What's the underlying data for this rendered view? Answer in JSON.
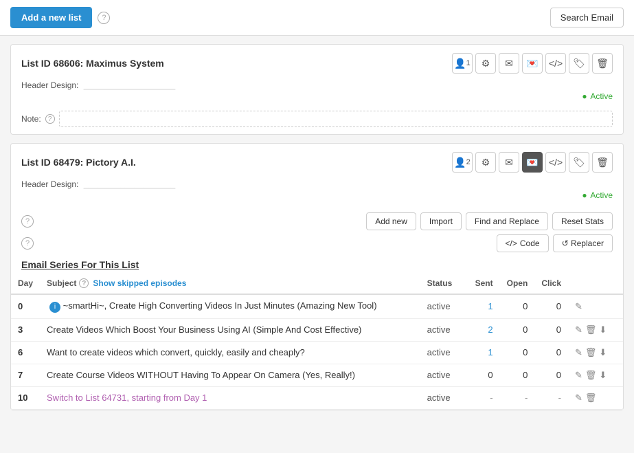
{
  "topBar": {
    "addNewListLabel": "Add a new list",
    "searchEmailLabel": "Search Email"
  },
  "lists": [
    {
      "id": "list-68606",
      "title": "List ID 68606: Maximus System",
      "headerDesignLabel": "Header Design:",
      "headerDesignValue": "____________________",
      "noteLabel": "Note:",
      "notePlaceholder": "",
      "status": "Active",
      "subscriberCount": "1",
      "actions": [
        "person-icon",
        "gear-icon",
        "email-icon",
        "envelope-icon",
        "code-icon",
        "tag-icon",
        "trash-icon"
      ]
    },
    {
      "id": "list-68479",
      "title": "List ID 68479: Pictory A.I.",
      "headerDesignLabel": "Header Design:",
      "headerDesignValue": "____________________",
      "status": "Active",
      "subscriberCount": "2",
      "actions": [
        "person-icon",
        "gear-icon",
        "email-icon",
        "envelope-icon",
        "code-icon",
        "tag-icon",
        "trash-icon"
      ]
    }
  ],
  "seriesSection": {
    "helpTooltip": "?",
    "toolbar": {
      "addNewLabel": "Add new",
      "importLabel": "Import",
      "findReplaceLabel": "Find and Replace",
      "resetStatsLabel": "Reset Stats"
    },
    "secondToolbar": {
      "helpTooltip": "?",
      "codeLabel": "Code",
      "replacerLabel": "Replacer"
    },
    "seriesTitle": "Email Series For This List",
    "table": {
      "columns": [
        "Day",
        "Subject",
        "Status",
        "Sent",
        "Open",
        "Click"
      ],
      "showSkippedLabel": "Show skipped episodes",
      "rows": [
        {
          "day": "0",
          "hasInfo": true,
          "subject": "~smartHi~, Create High Converting Videos In Just Minutes (Amazing New Tool)",
          "isLink": false,
          "status": "active",
          "sent": "1",
          "sentIsBlue": true,
          "open": "0",
          "click": "0",
          "actions": [
            "edit",
            "",
            ""
          ],
          "showCopy": false,
          "showDownload": false
        },
        {
          "day": "3",
          "hasInfo": false,
          "subject": "Create Videos Which Boost Your Business Using AI (Simple And Cost Effective)",
          "isLink": false,
          "status": "active",
          "sent": "2",
          "sentIsBlue": true,
          "open": "0",
          "click": "0",
          "actions": [
            "edit",
            "trash",
            "download"
          ],
          "showCopy": true,
          "showDownload": true
        },
        {
          "day": "6",
          "hasInfo": false,
          "subject": "Want to create videos which convert, quickly, easily and cheaply?",
          "isLink": false,
          "status": "active",
          "sent": "1",
          "sentIsBlue": true,
          "open": "0",
          "click": "0",
          "actions": [
            "edit",
            "trash",
            "download"
          ],
          "showCopy": true,
          "showDownload": true
        },
        {
          "day": "7",
          "hasInfo": false,
          "subject": "Create Course Videos WITHOUT Having To Appear On Camera (Yes, Really!)",
          "isLink": false,
          "status": "active",
          "sent": "0",
          "sentIsBlue": false,
          "open": "0",
          "click": "0",
          "actions": [
            "edit",
            "trash",
            "download"
          ],
          "showCopy": true,
          "showDownload": true
        },
        {
          "day": "10",
          "hasInfo": false,
          "subject": "Switch to List 64731, starting from Day 1",
          "isLink": true,
          "status": "active",
          "sent": "-",
          "sentIsBlue": false,
          "open": "-",
          "click": "-",
          "actions": [
            "edit",
            "trash"
          ],
          "showCopy": false,
          "showDownload": false
        }
      ]
    }
  }
}
